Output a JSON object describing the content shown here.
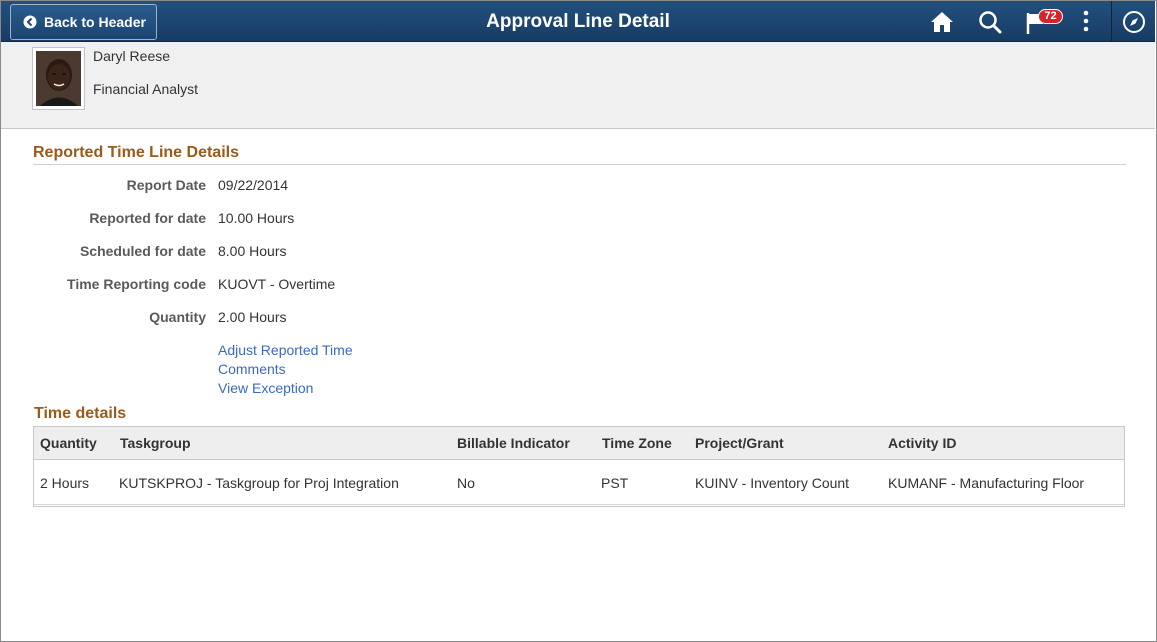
{
  "header": {
    "back_label": "Back to Header",
    "title": "Approval Line Detail",
    "notification_count": "72",
    "icons": [
      "home-icon",
      "search-icon",
      "flag-icon",
      "more-icon",
      "navbar-icon"
    ]
  },
  "employee": {
    "name": "Daryl Reese",
    "job_title": "Financial Analyst"
  },
  "reported_section": {
    "title": "Reported Time Line Details",
    "fields": [
      {
        "label": "Report Date",
        "value": "09/22/2014"
      },
      {
        "label": "Reported for date",
        "value": "10.00 Hours"
      },
      {
        "label": "Scheduled for date",
        "value": "8.00 Hours"
      },
      {
        "label": "Time Reporting code",
        "value": "KUOVT - Overtime"
      },
      {
        "label": "Quantity",
        "value": "2.00 Hours"
      }
    ],
    "links": [
      "Adjust Reported Time",
      "Comments",
      "View Exception"
    ]
  },
  "time_details": {
    "title": "Time details",
    "columns": [
      "Quantity",
      "Taskgroup",
      "Billable Indicator",
      "Time Zone",
      "Project/Grant",
      "Activity ID"
    ],
    "rows": [
      [
        "2 Hours",
        "KUTSKPROJ - Taskgroup for Proj Integration",
        "No",
        "PST",
        "KUINV - Inventory Count",
        "KUMANF - Manufacturing Floor"
      ]
    ]
  },
  "colors": {
    "banner": "#1d4670",
    "section_title": "#9b5a19",
    "link": "#3a6ac4",
    "badge": "#d8232a"
  }
}
